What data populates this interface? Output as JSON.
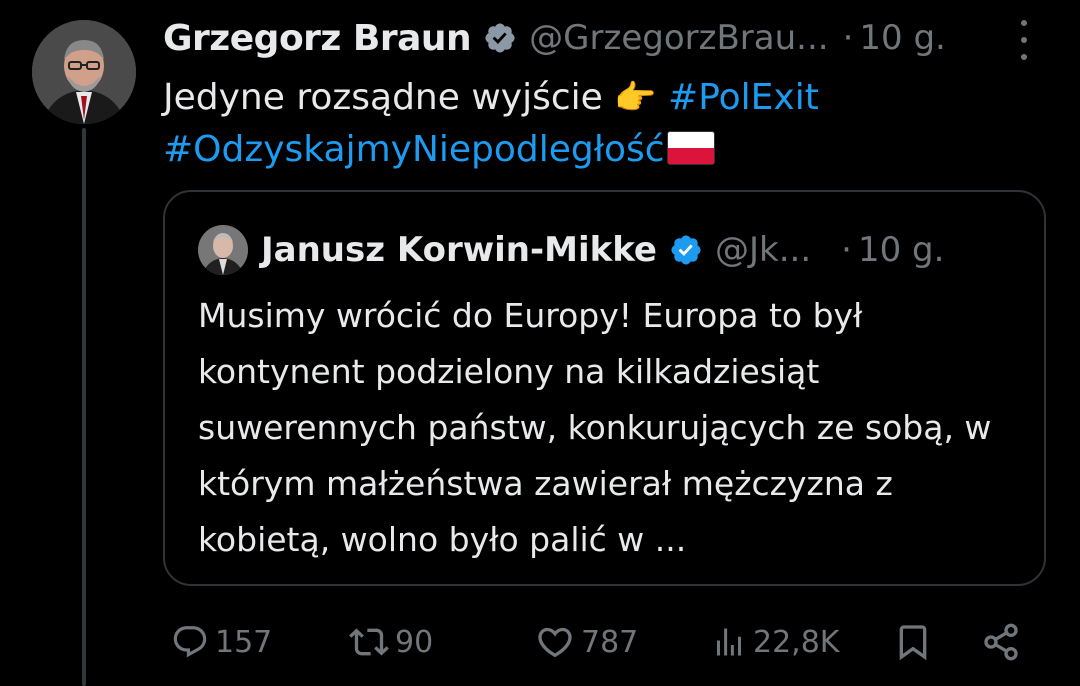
{
  "tweet": {
    "author_name": "Grzegorz Braun",
    "author_handle": "@GrzegorzBrau...",
    "dot": "·",
    "time": "10 g.",
    "text_before": "Jedyne rozsądne wyjście ",
    "emoji": "👉",
    "hashtag_1": "#PolExit",
    "hashtag_2": "#OdzyskajmyNiepodległość",
    "flag_icon": "poland-flag-icon"
  },
  "quote": {
    "author_name": "Janusz Korwin-Mikke",
    "author_handle": "@Jk...",
    "dot": "·",
    "time": "10 g.",
    "text": "Musimy wrócić do Europy! Europa to był kontynent podzielony na kilkadziesiąt suwerennych państw, konkurujących ze sobą, w którym małżeństwa zawierał mężczyzna z kobietą, wolno było palić w ..."
  },
  "actions": {
    "replies": "157",
    "reposts": "90",
    "likes": "787",
    "views": "22,8K"
  },
  "colors": {
    "background": "#000000",
    "text": "#e7e9ea",
    "secondary": "#71767b",
    "accent": "#1d9bf0",
    "border": "#2f3336"
  }
}
